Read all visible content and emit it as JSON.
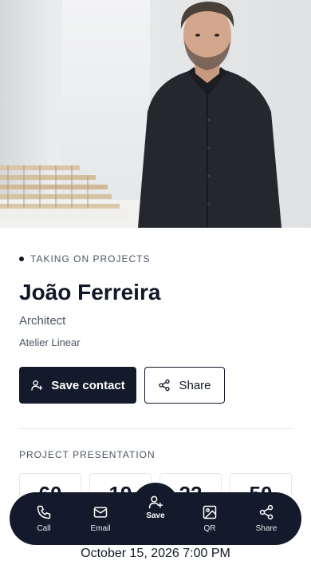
{
  "hero": {
    "alt": "Portrait of João Ferreira"
  },
  "status": {
    "text": "TAKING ON PROJECTS"
  },
  "profile": {
    "name": "João Ferreira",
    "role": "Architect",
    "company": "Atelier Linear"
  },
  "actions": {
    "save_contact": "Save contact",
    "share": "Share"
  },
  "presentation": {
    "label": "PROJECT PRESENTATION",
    "countdown": [
      "60",
      "19",
      "22",
      "50"
    ],
    "date": "October 15, 2026 7:00 PM"
  },
  "nav": {
    "call": "Call",
    "email": "Email",
    "save": "Save",
    "qr": "QR",
    "share": "Share"
  },
  "colors": {
    "accent": "#131a2b",
    "text": "#111827",
    "muted": "#4b5563"
  }
}
